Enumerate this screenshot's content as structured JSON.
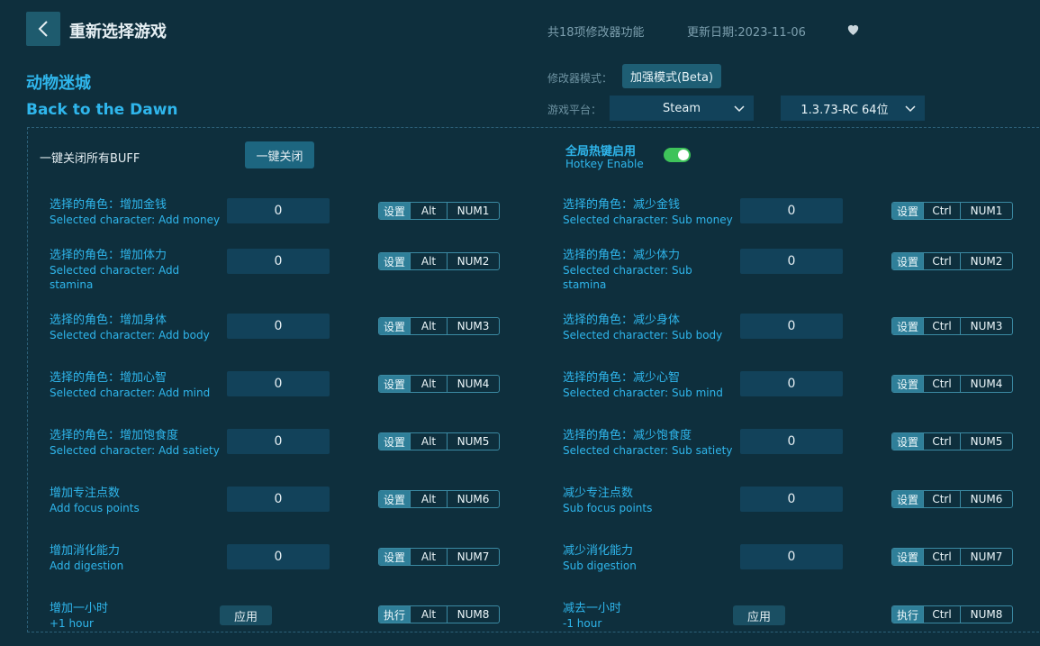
{
  "header": {
    "back_label": "‹",
    "title": "重新选择游戏",
    "feature_count": "共18项修改器功能",
    "update_date": "更新日期:2023-11-06"
  },
  "game": {
    "name_cn": "动物迷城",
    "name_en": "Back to the Dawn"
  },
  "settings": {
    "mode_label": "修改器模式：",
    "mode_value": "加强模式(Beta)",
    "platform_label": "游戏平台：",
    "platform_value": "Steam",
    "version_value": "1.3.73-RC 64位"
  },
  "global": {
    "close_all_label": "一键关闭所有BUFF",
    "close_all_button": "一键关闭",
    "hotkey_title": "全局热键启用",
    "hotkey_sub": "Hotkey Enable",
    "hotkey_enabled": true
  },
  "options": [
    {
      "cn": "选择的角色：增加金钱",
      "en": "Selected character: Add money",
      "value": "0",
      "type": "input",
      "set": "设置",
      "mod": "Alt",
      "key": "NUM1"
    },
    {
      "cn": "选择的角色：减少金钱",
      "en": "Selected character: Sub money",
      "value": "0",
      "type": "input",
      "set": "设置",
      "mod": "Ctrl",
      "key": "NUM1"
    },
    {
      "cn": "选择的角色：增加体力",
      "en": "Selected character: Add stamina",
      "value": "0",
      "type": "input",
      "set": "设置",
      "mod": "Alt",
      "key": "NUM2"
    },
    {
      "cn": "选择的角色：减少体力",
      "en": "Selected character: Sub stamina",
      "value": "0",
      "type": "input",
      "set": "设置",
      "mod": "Ctrl",
      "key": "NUM2"
    },
    {
      "cn": "选择的角色：增加身体",
      "en": "Selected character: Add body",
      "value": "0",
      "type": "input",
      "set": "设置",
      "mod": "Alt",
      "key": "NUM3"
    },
    {
      "cn": "选择的角色：减少身体",
      "en": "Selected character: Sub body",
      "value": "0",
      "type": "input",
      "set": "设置",
      "mod": "Ctrl",
      "key": "NUM3"
    },
    {
      "cn": "选择的角色：增加心智",
      "en": "Selected character: Add mind",
      "value": "0",
      "type": "input",
      "set": "设置",
      "mod": "Alt",
      "key": "NUM4"
    },
    {
      "cn": "选择的角色：减少心智",
      "en": "Selected character: Sub mind",
      "value": "0",
      "type": "input",
      "set": "设置",
      "mod": "Ctrl",
      "key": "NUM4"
    },
    {
      "cn": "选择的角色：增加饱食度",
      "en": "Selected character: Add satiety",
      "value": "0",
      "type": "input",
      "set": "设置",
      "mod": "Alt",
      "key": "NUM5"
    },
    {
      "cn": "选择的角色：减少饱食度",
      "en": "Selected character: Sub satiety",
      "value": "0",
      "type": "input",
      "set": "设置",
      "mod": "Ctrl",
      "key": "NUM5"
    },
    {
      "cn": "增加专注点数",
      "en": "Add focus points",
      "value": "0",
      "type": "input",
      "set": "设置",
      "mod": "Alt",
      "key": "NUM6"
    },
    {
      "cn": "减少专注点数",
      "en": "Sub focus points",
      "value": "0",
      "type": "input",
      "set": "设置",
      "mod": "Ctrl",
      "key": "NUM6"
    },
    {
      "cn": "增加消化能力",
      "en": "Add digestion",
      "value": "0",
      "type": "input",
      "set": "设置",
      "mod": "Alt",
      "key": "NUM7"
    },
    {
      "cn": "减少消化能力",
      "en": "Sub digestion",
      "value": "0",
      "type": "input",
      "set": "设置",
      "mod": "Ctrl",
      "key": "NUM7"
    },
    {
      "cn": "增加一小时",
      "en": "+1 hour",
      "apply": "应用",
      "type": "apply",
      "set": "执行",
      "mod": "Alt",
      "key": "NUM8"
    },
    {
      "cn": "减去一小时",
      "en": "-1 hour",
      "apply": "应用",
      "type": "apply",
      "set": "执行",
      "mod": "Ctrl",
      "key": "NUM8"
    }
  ],
  "colors": {
    "background": "#0e2f3d",
    "accent": "#2fb6ec",
    "toggle_on": "#3ec35a"
  }
}
